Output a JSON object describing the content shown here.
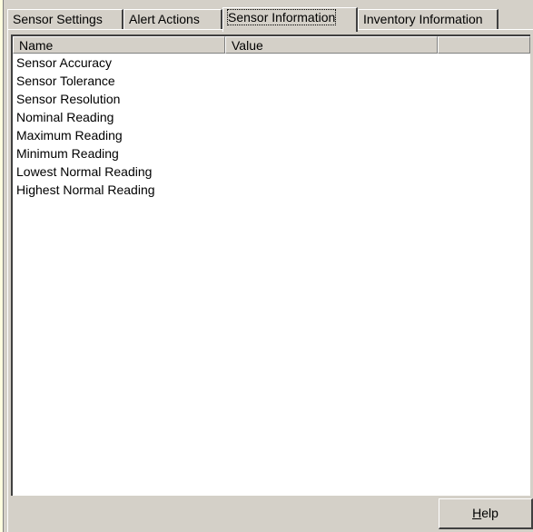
{
  "tabs": [
    {
      "label": "Sensor Settings",
      "active": false
    },
    {
      "label": "Alert Actions",
      "active": false
    },
    {
      "label": "Sensor Information",
      "active": true
    },
    {
      "label": "Inventory Information",
      "active": false
    }
  ],
  "list": {
    "columns": [
      "Name",
      "Value",
      ""
    ],
    "rows": [
      {
        "name": "Sensor Accuracy",
        "value": ""
      },
      {
        "name": "Sensor Tolerance",
        "value": ""
      },
      {
        "name": "Sensor Resolution",
        "value": ""
      },
      {
        "name": "Nominal Reading",
        "value": ""
      },
      {
        "name": "Maximum Reading",
        "value": ""
      },
      {
        "name": "Minimum Reading",
        "value": ""
      },
      {
        "name": "Lowest Normal Reading",
        "value": ""
      },
      {
        "name": "Highest Normal Reading",
        "value": ""
      }
    ]
  },
  "footer": {
    "help_mnemonic": "H",
    "help_rest": "elp"
  },
  "colors": {
    "face": "#d4d0c8",
    "background": "#fefedf",
    "list_bg": "#ffffff"
  }
}
